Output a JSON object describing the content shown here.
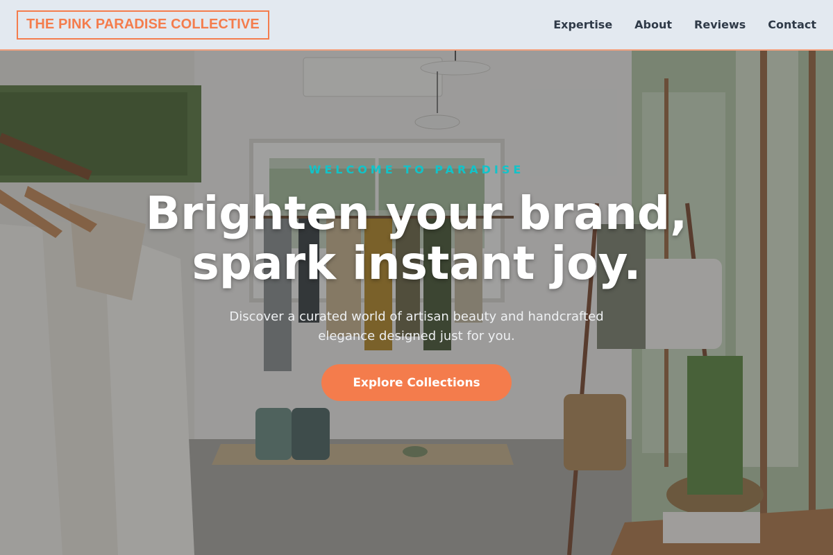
{
  "brand": {
    "logo_text": "THE PINK PARADISE COLLECTIVE"
  },
  "nav": {
    "items": [
      {
        "label": "Expertise"
      },
      {
        "label": "About"
      },
      {
        "label": "Reviews"
      },
      {
        "label": "Contact"
      }
    ]
  },
  "hero": {
    "eyebrow": "WELCOME TO PARADISE",
    "headline_line1": "Brighten your brand,",
    "headline_line2": "spark instant joy.",
    "subtext": "Discover a curated world of artisan beauty and handcrafted elegance designed just for you.",
    "cta_label": "Explore Collections",
    "background_image": "boutique-interior-photo"
  },
  "colors": {
    "accent": "#f47c4c",
    "eyebrow": "#12c3c9",
    "header_bg": "#e3e9f0",
    "nav_text": "#2f3a48"
  }
}
